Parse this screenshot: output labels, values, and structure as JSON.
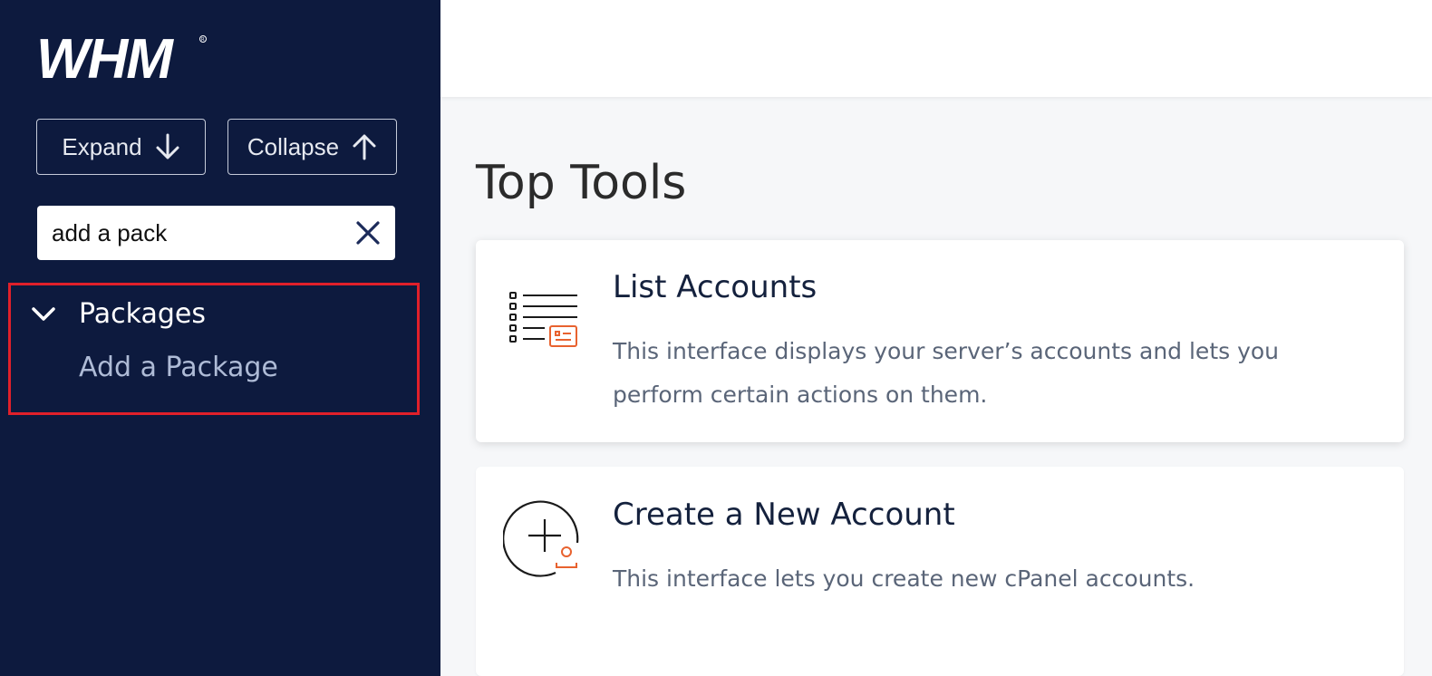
{
  "sidebar": {
    "logo_text": "WHM",
    "expand_label": "Expand",
    "collapse_label": "Collapse",
    "search": {
      "value": "add a pack",
      "placeholder": ""
    },
    "results": {
      "group_label": "Packages",
      "items": [
        {
          "label": "Add a Package"
        }
      ]
    }
  },
  "main": {
    "section_title": "Top Tools",
    "tools": [
      {
        "title": "List Accounts",
        "description": "This interface displays your server’s accounts and lets you perform certain actions on them.",
        "icon": "list-accounts-icon"
      },
      {
        "title": "Create a New Account",
        "description": "This interface lets you create new cPanel accounts.",
        "icon": "create-account-icon"
      }
    ]
  },
  "colors": {
    "sidebar_bg": "#0d1a3e",
    "highlight_border": "#e0202a",
    "icon_accent": "#e8622f",
    "nav_item_text": "#aebbd6"
  }
}
